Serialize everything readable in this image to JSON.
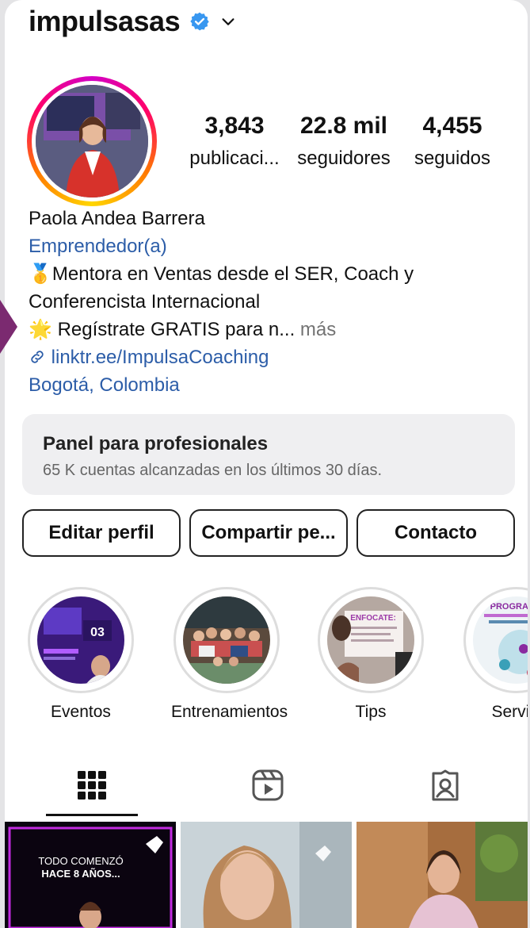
{
  "header": {
    "username": "impulsasas",
    "verified_icon": "verified-badge-icon",
    "dropdown_icon": "chevron-down-icon"
  },
  "stats": [
    {
      "value": "3,843",
      "label": "publicaci..."
    },
    {
      "value": "22.8 mil",
      "label": "seguidores"
    },
    {
      "value": "4,455",
      "label": "seguidos"
    }
  ],
  "bio": {
    "name": "Paola Andea Barrera",
    "category": "Emprendedor(a)",
    "line1": "Mentora en Ventas desde el SER, Coach y",
    "line2": "Conferencista Internacional",
    "line3": "Regístrate GRATIS para n...",
    "more": "más",
    "link": "linktr.ee/ImpulsaCoaching",
    "location": "Bogotá, Colombia"
  },
  "panel": {
    "title": "Panel para profesionales",
    "subtitle": "65 K cuentas alcanzadas en los últimos 30 días."
  },
  "buttons": {
    "edit": "Editar perfil",
    "share": "Compartir pe...",
    "contact": "Contacto"
  },
  "highlights": [
    {
      "label": "Eventos",
      "badge": "03"
    },
    {
      "label": "Entrenamientos"
    },
    {
      "label": "Tips",
      "badge": "ENFOCATE:"
    },
    {
      "label": "Servici",
      "badge": "PROGRAMAS"
    }
  ],
  "tabs": [
    "grid-icon",
    "reels-icon",
    "tagged-icon"
  ],
  "posts": [
    {
      "text1": "TODO COMENZÓ",
      "text2": "HACE 8 AÑOS..."
    },
    {},
    {}
  ],
  "colors": {
    "link": "#2c5da8",
    "ring_start": "#d300c5",
    "ring_end": "#ffd600"
  }
}
